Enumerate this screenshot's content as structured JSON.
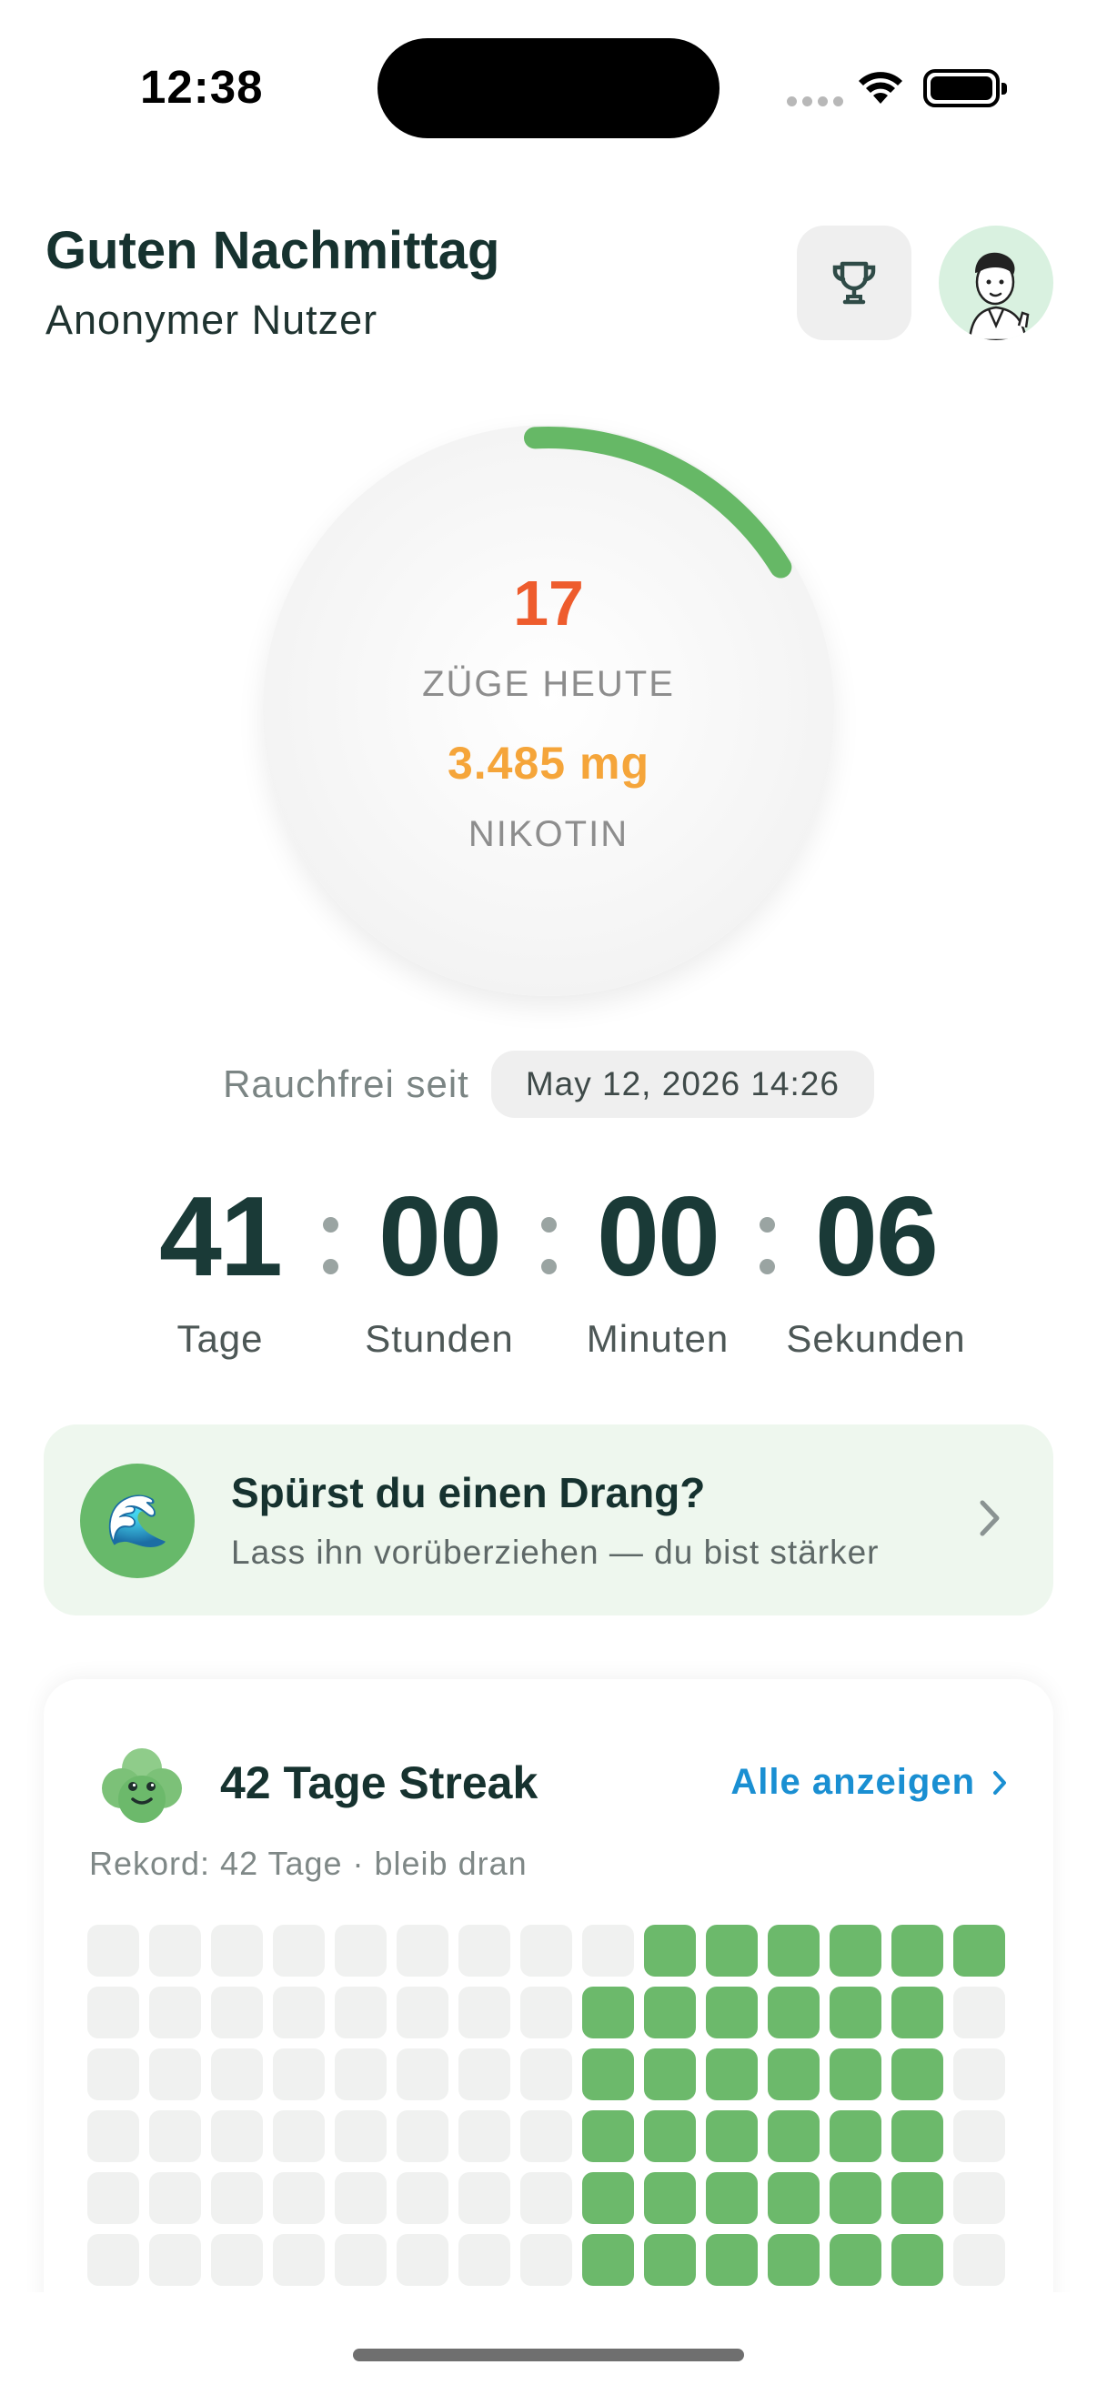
{
  "status_bar": {
    "time": "12:38"
  },
  "header": {
    "greeting": "Guten Nachmittag",
    "username": "Anonymer Nutzer",
    "trophy_icon": "trophy-icon",
    "avatar_icon": "avatar-illustration"
  },
  "ring": {
    "puffs": "17",
    "puffs_label": "ZÜGE HEUTE",
    "nicotine": "3.485 mg",
    "nicotine_label": "NIKOTIN",
    "progress": 0.17,
    "colors": {
      "progress": "#66b866",
      "puffs": "#ee5c2d",
      "nicotine": "#f5a53a"
    }
  },
  "smoke_free": {
    "label": "Rauchfrei seit",
    "date": "May 12, 2026 14:26"
  },
  "timer": {
    "days": "41",
    "days_label": "Tage",
    "hours": "00",
    "hours_label": "Stunden",
    "minutes": "00",
    "minutes_label": "Minuten",
    "seconds": "06",
    "seconds_label": "Sekunden"
  },
  "urge_card": {
    "icon": "🌊",
    "title": "Spürst du einen Drang?",
    "subtitle": "Lass ihn vorüberziehen — du bist stärker"
  },
  "streak": {
    "title": "42 Tage Streak",
    "show_all": "Alle anzeigen",
    "record": "Rekord: 42 Tage · bleib dran",
    "grid_columns": 15,
    "grid_rows": 6,
    "grid_filled": [
      [
        9,
        10,
        11,
        12,
        13,
        14
      ],
      [
        8,
        9,
        10,
        11,
        12,
        13
      ],
      [
        8,
        9,
        10,
        11,
        12,
        13
      ],
      [
        8,
        9,
        10,
        11,
        12,
        13
      ],
      [
        8,
        9,
        10,
        11,
        12,
        13
      ],
      [
        8,
        9,
        10,
        11,
        12,
        13
      ]
    ],
    "colors": {
      "filled": "#6cb96b",
      "empty": "#f0f1f0"
    }
  }
}
